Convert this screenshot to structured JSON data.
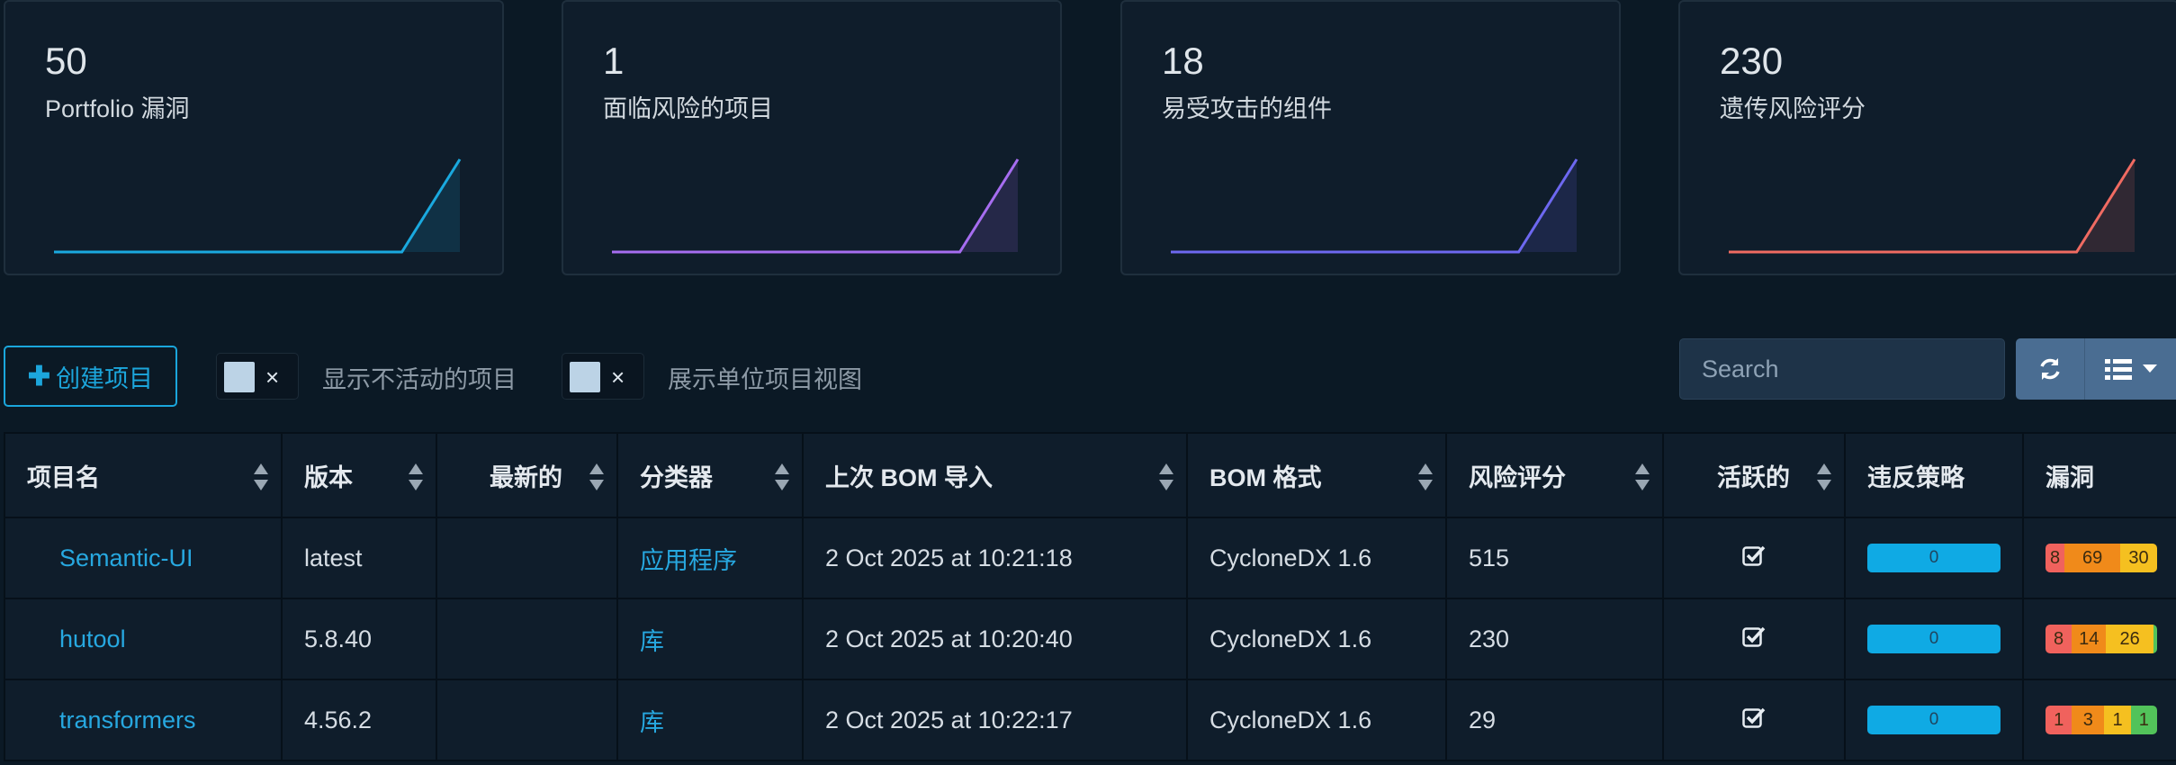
{
  "metrics": [
    {
      "value": "50",
      "label": "Portfolio 漏洞",
      "color": "#1aa9df",
      "series": [
        0,
        0,
        0,
        0,
        0,
        0,
        0,
        50
      ]
    },
    {
      "value": "1",
      "label": "面临风险的项目",
      "color": "#a66df0",
      "series": [
        0,
        0,
        0,
        0,
        0,
        0,
        0,
        1
      ]
    },
    {
      "value": "18",
      "label": "易受攻击的组件",
      "color": "#6d68f0",
      "series": [
        0,
        0,
        0,
        0,
        0,
        0,
        0,
        18
      ]
    },
    {
      "value": "230",
      "label": "遗传风险评分",
      "color": "#f06b62",
      "series": [
        0,
        0,
        0,
        0,
        0,
        0,
        0,
        230
      ]
    }
  ],
  "toolbar": {
    "create_label": "创建项目",
    "toggle_inactive_label": "显示不活动的项目",
    "toggle_flat_label": "展示单位项目视图",
    "toggle_x": "×",
    "search_placeholder": "Search"
  },
  "table": {
    "headers": [
      "项目名",
      "版本",
      "最新的",
      "分类器",
      "上次 BOM 导入",
      "BOM 格式",
      "风险评分",
      "活跃的",
      "违反策略",
      "漏洞"
    ],
    "rows": [
      {
        "name": "Semantic-UI",
        "version": "latest",
        "latest": "",
        "classifier": "应用程序",
        "last_import": "2 Oct 2025 at 10:21:18",
        "format": "CycloneDX 1.6",
        "risk": "515",
        "active": true,
        "policy": "0",
        "vulns": [
          {
            "v": "8",
            "c": "#f0625d"
          },
          {
            "v": "69",
            "c": "#f08a1a"
          },
          {
            "v": "30",
            "c": "#f5c020"
          }
        ]
      },
      {
        "name": "hutool",
        "version": "5.8.40",
        "latest": "",
        "classifier": "库",
        "last_import": "2 Oct 2025 at 10:20:40",
        "format": "CycloneDX 1.6",
        "risk": "230",
        "active": true,
        "policy": "0",
        "vulns": [
          {
            "v": "8",
            "c": "#f0625d"
          },
          {
            "v": "14",
            "c": "#f08a1a"
          },
          {
            "v": "26",
            "c": "#f5c020"
          },
          {
            "v": "",
            "c": "#52c35a"
          }
        ]
      },
      {
        "name": "transformers",
        "version": "4.56.2",
        "latest": "",
        "classifier": "库",
        "last_import": "2 Oct 2025 at 10:22:17",
        "format": "CycloneDX 1.6",
        "risk": "29",
        "active": true,
        "policy": "0",
        "vulns": [
          {
            "v": "1",
            "c": "#f0625d"
          },
          {
            "v": "3",
            "c": "#f08a1a"
          },
          {
            "v": "1",
            "c": "#f5c020"
          },
          {
            "v": "1",
            "c": "#52c35a"
          }
        ]
      }
    ]
  }
}
